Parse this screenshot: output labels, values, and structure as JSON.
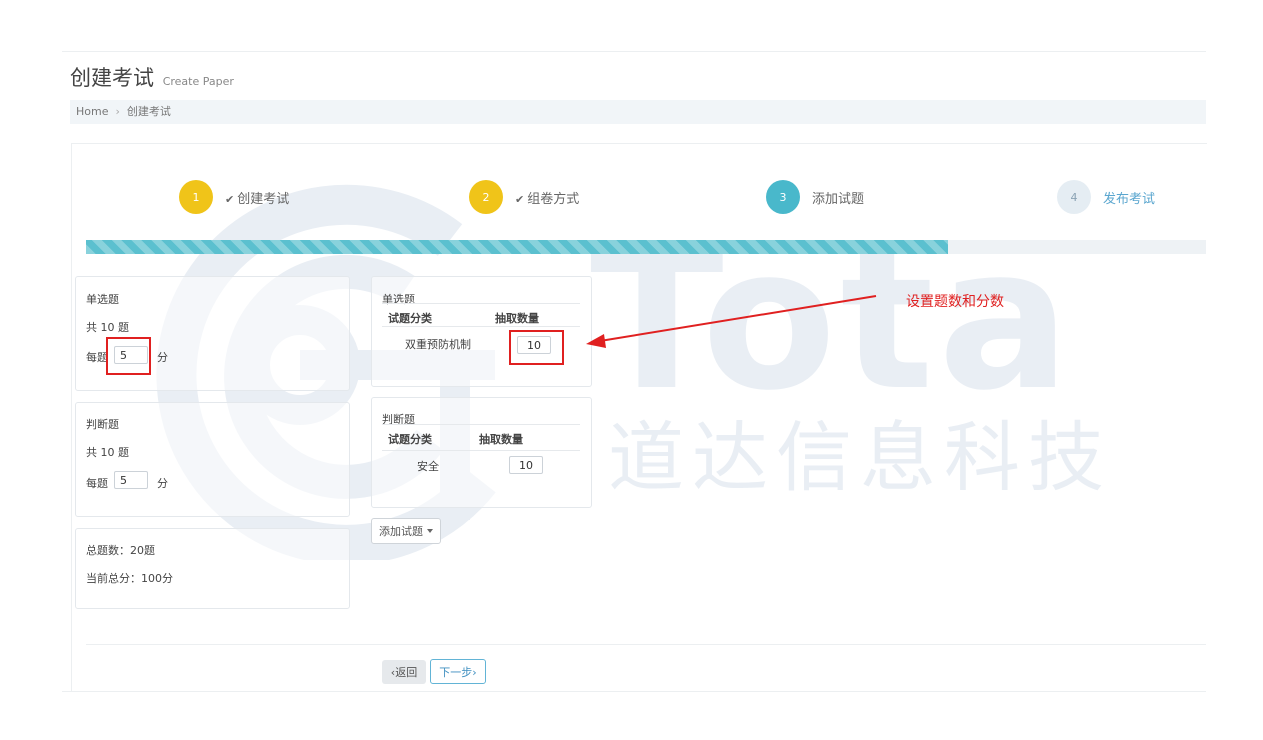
{
  "page": {
    "title": "创建考试",
    "subtitle": "Create Paper"
  },
  "breadcrumb": {
    "home": "Home",
    "separator": "›",
    "current": "创建考试"
  },
  "watermark": {
    "brand": "Tota",
    "company": "道达信息科技"
  },
  "steps": [
    {
      "number": "1",
      "label": "创建考试",
      "check": "✔",
      "color": "#f0c419"
    },
    {
      "number": "2",
      "label": "组卷方式",
      "check": "✔",
      "color": "#f0c419"
    },
    {
      "number": "3",
      "label": "添加试题",
      "color": "#49b8cb"
    },
    {
      "number": "4",
      "label": "发布考试",
      "color": "#e5edf3"
    }
  ],
  "progress": {
    "percent": 77,
    "color": "#5bc0cf"
  },
  "left": {
    "single": {
      "title": "单选题",
      "total": "共 10 题",
      "per_label": "每题",
      "per_value": "5",
      "unit": "分"
    },
    "judge": {
      "title": "判断题",
      "total": "共 10 题",
      "per_label": "每题",
      "per_value": "5",
      "unit": "分"
    },
    "summary": {
      "total_questions": "总题数：20题",
      "total_score": "当前总分：100分"
    }
  },
  "middle": {
    "single": {
      "title": "单选题",
      "col_category": "试题分类",
      "col_count": "抽取数量",
      "category": "双重预防机制",
      "count": "10"
    },
    "judge": {
      "title": "判断题",
      "col_category": "试题分类",
      "col_count": "抽取数量",
      "category": "安全",
      "count": "10"
    },
    "add_button": "添加试题"
  },
  "footer": {
    "back": "‹返回",
    "next": "下一步›"
  },
  "annotation": {
    "text": "设置题数和分数",
    "color": "#e02020"
  }
}
